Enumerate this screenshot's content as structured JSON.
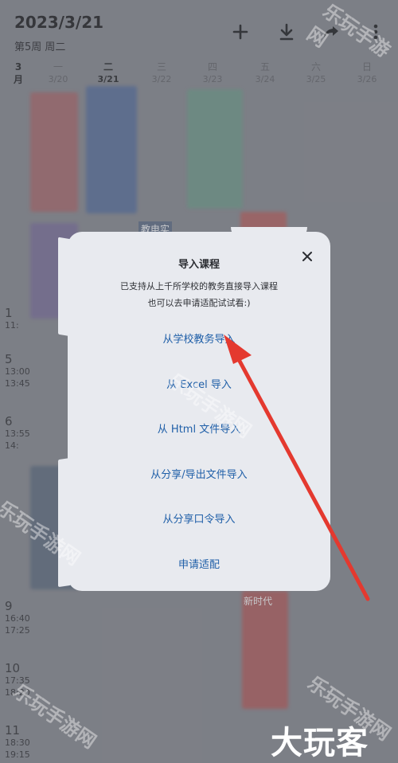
{
  "header": {
    "date": "2023/3/21",
    "week": "第5周  周二",
    "actions": [
      {
        "name": "add-icon"
      },
      {
        "name": "download-icon"
      },
      {
        "name": "share-icon"
      },
      {
        "name": "more-icon"
      }
    ]
  },
  "calendar": {
    "month": "3\n月",
    "days": [
      {
        "weekday": "一",
        "date": "3/20",
        "current": false
      },
      {
        "weekday": "二",
        "date": "3/21",
        "current": true
      },
      {
        "weekday": "三",
        "date": "3/22",
        "current": false
      },
      {
        "weekday": "四",
        "date": "3/23",
        "current": false
      },
      {
        "weekday": "五",
        "date": "3/24",
        "current": false
      },
      {
        "weekday": "六",
        "date": "3/25",
        "current": false
      },
      {
        "weekday": "日",
        "date": "3/26",
        "current": false
      }
    ],
    "periods": [
      {
        "num": "1",
        "start": "11:",
        "end": ""
      },
      {
        "num": "5",
        "start": "13:00",
        "end": "13:45"
      },
      {
        "num": "6",
        "start": "13:55",
        "end": "14:"
      },
      {
        "num": "9",
        "start": "16:40",
        "end": "17:25"
      },
      {
        "num": "10",
        "start": "17:35",
        "end": "18:20"
      },
      {
        "num": "11",
        "start": "18:30",
        "end": "19:15"
      }
    ],
    "course_labels": [
      "教电实",
      "新时代"
    ]
  },
  "dialog": {
    "title": "导入课程",
    "description_line1": "已支持从上千所学校的教务直接导入课程",
    "description_line2": "也可以去申请适配试试看:)",
    "options": [
      "从学校教务导入",
      "从 Excel 导入",
      "从 Html 文件导入",
      "从分享/导出文件导入",
      "从分享口令导入",
      "申请适配"
    ]
  },
  "watermark": {
    "text": "乐玩手游网",
    "brand": "大玩客"
  },
  "colors": {
    "accent_link": "#1f5fa8",
    "arrow": "#e4392f",
    "dialog_bg": "#e8eaef"
  }
}
